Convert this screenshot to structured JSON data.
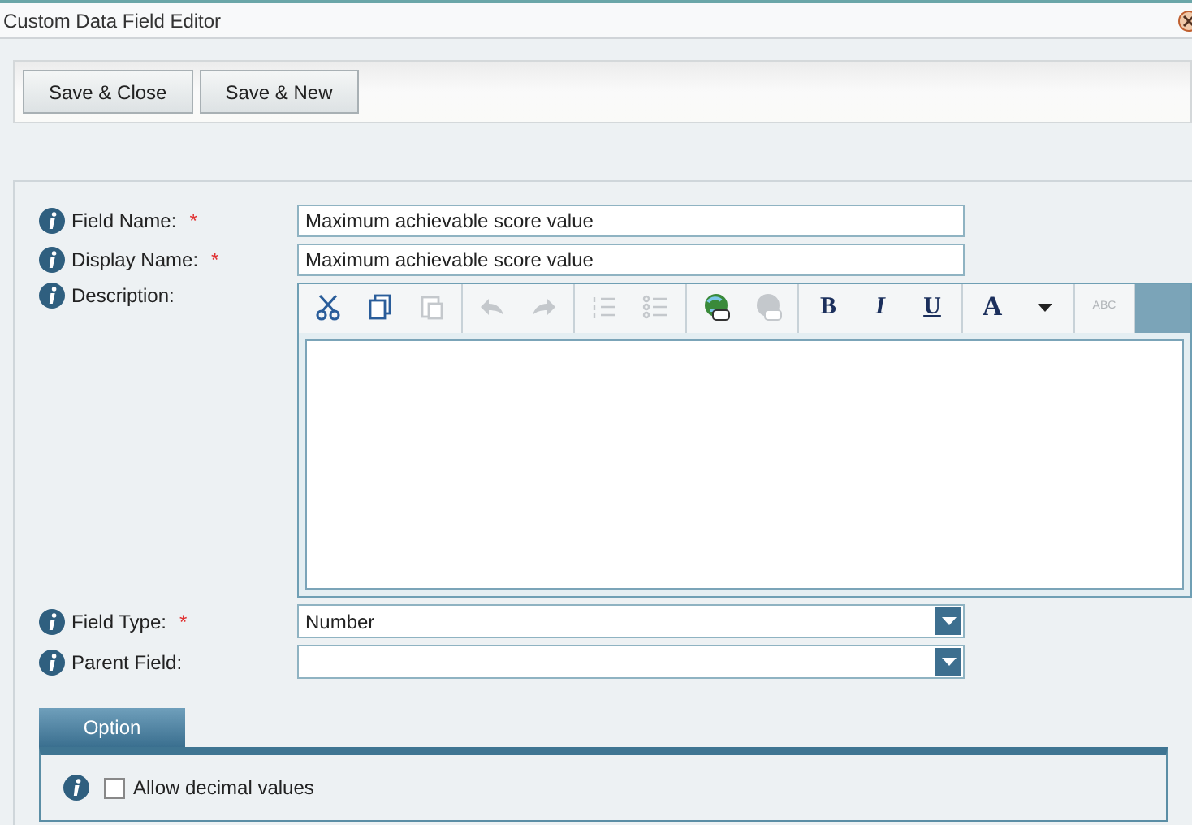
{
  "window": {
    "title": "Custom Data Field Editor"
  },
  "buttons": [
    "Save & Close",
    "Save & New"
  ],
  "fields": [
    {
      "kind": "text",
      "label": "Field Name:",
      "required": true,
      "value": "Maximum achievable score value"
    },
    {
      "kind": "text",
      "label": "Display Name:",
      "required": true,
      "value": "Maximum achievable score value"
    },
    {
      "kind": "editor",
      "label": "Description:",
      "required": false
    },
    {
      "kind": "select",
      "label": "Field Type:",
      "required": true,
      "value": "Number"
    },
    {
      "kind": "select",
      "label": "Parent Field:",
      "required": false
    }
  ],
  "required_mark": "*",
  "editor_toolbar": [
    [
      {
        "kind": "cut",
        "disabled": false
      },
      {
        "kind": "copy",
        "disabled": false
      },
      {
        "kind": "paste",
        "disabled": true
      }
    ],
    [
      {
        "kind": "undo",
        "disabled": true
      },
      {
        "kind": "redo",
        "disabled": true
      }
    ],
    [
      {
        "kind": "ordered-list",
        "disabled": true
      },
      {
        "kind": "bullet-list",
        "disabled": true
      }
    ],
    [
      {
        "kind": "link",
        "disabled": false
      },
      {
        "kind": "unlink",
        "disabled": true
      }
    ],
    [
      {
        "kind": "bold",
        "label": "B",
        "disabled": false
      },
      {
        "kind": "italic",
        "label": "I",
        "disabled": false
      },
      {
        "kind": "underline",
        "label": "U",
        "disabled": false
      }
    ],
    [
      {
        "kind": "font-color",
        "label": "A",
        "disabled": false
      },
      {
        "kind": "dropdown",
        "disabled": false
      }
    ],
    [
      {
        "kind": "spellcheck",
        "label": "ABC",
        "disabled": true
      }
    ]
  ],
  "options_tab": {
    "label": "Option",
    "selected": true
  },
  "options": [
    {
      "label": "Allow decimal values",
      "checked": false
    }
  ]
}
